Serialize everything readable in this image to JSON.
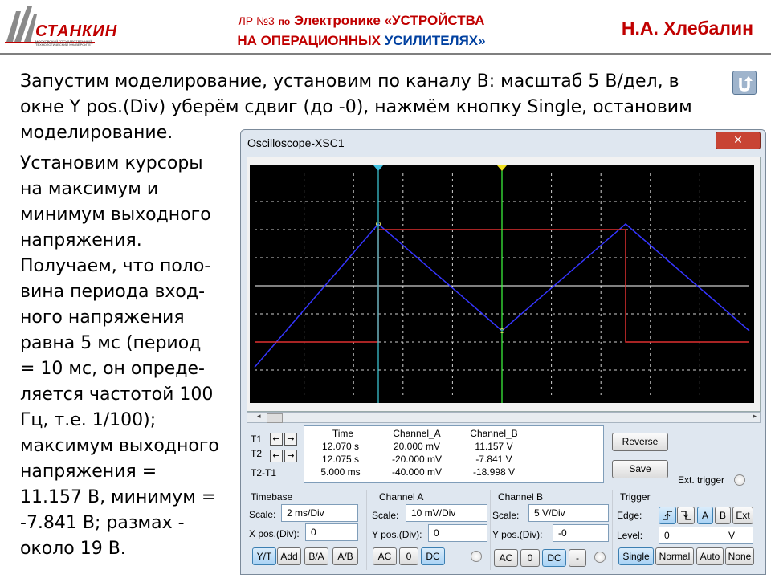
{
  "header": {
    "logo_text": "СТАНКИН",
    "logo_subtitle": "МОСКОВСКИЙ ГОСУДАРСТВЕННЫЙ ТЕХНОЛОГИЧЕСКИЙ УНИВЕРСИТЕТ",
    "title_lr": "ЛР №3",
    "title_po": "по",
    "title_part1": "Электронике «УСТРОЙСТВА",
    "title_part2a": "НА ОПЕРАЦИОННЫХ",
    "title_part2b": "УСИЛИТЕЛЯХ»",
    "author": "Н.А. Хлебалин"
  },
  "intro_lines": [
    "Запустим моделирование, установим по каналу B: масштаб 5 В/дел, в",
    "окне Y pos.(Div) уберём сдвиг (до -0), нажмём кнопку Single, остановим",
    "моделирование."
  ],
  "side_lines": [
    "Установим курсоры",
    "на максимум и",
    "минимум выходного",
    "напряжения.",
    "Получаем, что поло-",
    "вина периода вход-",
    "ного напряжения",
    "равна 5 мс (период",
    "= 10 мс, он опреде-",
    "ляется частотой 100",
    "Гц, т.е.  1/100);",
    "максимум выходного",
    "напряжения =",
    "11.157 В, минимум =",
    "-7.841 В; размах -",
    "около 19 В."
  ],
  "window": {
    "title": "Oscilloscope-XSC1",
    "close_glyph": "✕"
  },
  "readout": {
    "headers": [
      "Time",
      "Channel_A",
      "Channel_B"
    ],
    "rows": [
      {
        "label": "T1",
        "time": "12.070 s",
        "a": "20.000 mV",
        "b": "11.157 V"
      },
      {
        "label": "T2",
        "time": "12.075 s",
        "a": "-20.000 mV",
        "b": "-7.841 V"
      },
      {
        "label": "T2-T1",
        "time": "5.000 ms",
        "a": "-40.000 mV",
        "b": "-18.998 V"
      }
    ]
  },
  "buttons": {
    "reverse": "Reverse",
    "save": "Save",
    "ext_trigger": "Ext. trigger"
  },
  "timebase": {
    "title": "Timebase",
    "scale_label": "Scale:",
    "scale_value": "2 ms/Div",
    "xpos_label": "X pos.(Div):",
    "xpos_value": "0",
    "modes": [
      "Y/T",
      "Add",
      "B/A",
      "A/B"
    ]
  },
  "channel_a": {
    "title": "Channel A",
    "scale_label": "Scale:",
    "scale_value": "10 mV/Div",
    "ypos_label": "Y pos.(Div):",
    "ypos_value": "0",
    "coupling": [
      "AC",
      "0",
      "DC"
    ]
  },
  "channel_b": {
    "title": "Channel B",
    "scale_label": "Scale:",
    "scale_value": "5  V/Div",
    "ypos_label": "Y pos.(Div):",
    "ypos_value": "-0",
    "coupling": [
      "AC",
      "0",
      "DC",
      "-"
    ]
  },
  "trigger": {
    "title": "Trigger",
    "edge_label": "Edge:",
    "edge_buttons": [
      "A",
      "B",
      "Ext"
    ],
    "level_label": "Level:",
    "level_value": "0",
    "level_unit": "V",
    "modes": [
      "Single",
      "Normal",
      "Auto",
      "None"
    ]
  },
  "chart_data": {
    "type": "line",
    "x_unit": "ms",
    "x": [
      0,
      5,
      10,
      15,
      20
    ],
    "xlim": [
      0,
      20
    ],
    "ylim": [
      -4,
      4
    ],
    "grid": true,
    "series": [
      {
        "color": "#3535ff",
        "x": [
          0,
          5,
          10,
          15,
          20
        ],
        "y": [
          -2.9,
          2.2,
          -1.6,
          2.2,
          -1.6
        ]
      },
      {
        "color": "#e03030",
        "x": [
          0,
          5,
          5,
          15,
          15,
          20
        ],
        "y": [
          -2.0,
          -2.0,
          2.0,
          2.0,
          -2.0,
          -2.0
        ]
      }
    ],
    "cursors": [
      {
        "name": "T1",
        "color": "#40d0e0",
        "x": 5.0
      },
      {
        "name": "T2",
        "color": "#40ff40",
        "x": 10.0
      }
    ]
  }
}
